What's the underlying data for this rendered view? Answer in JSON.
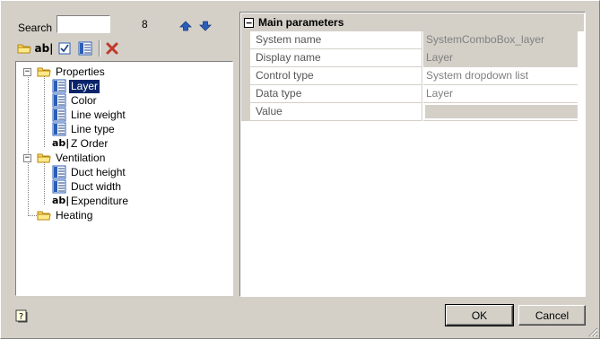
{
  "search": {
    "label": "Search",
    "value": "",
    "count": "8"
  },
  "toolbar": {
    "folder_icon": "folder-icon",
    "text_icon": "text-field-icon",
    "checkbox_icon": "checkbox-icon",
    "list_icon": "list-icon",
    "delete_icon": "delete-icon"
  },
  "tree": {
    "group_properties": "Properties",
    "layer": "Layer",
    "color": "Color",
    "line_weight": "Line weight",
    "line_type": "Line type",
    "z_order": "Z Order",
    "group_ventilation": "Ventilation",
    "duct_height": "Duct height",
    "duct_width": "Duct width",
    "expenditure": "Expenditure",
    "group_heating": "Heating"
  },
  "panel": {
    "header": "Main parameters",
    "rows": [
      {
        "name": "System name",
        "value": "SystemComboBox_layer"
      },
      {
        "name": "Display name",
        "value": "Layer"
      },
      {
        "name": "Control type",
        "value": "System dropdown list"
      },
      {
        "name": "Data type",
        "value": "Layer"
      },
      {
        "name": "Value",
        "value": ""
      }
    ]
  },
  "buttons": {
    "ok": "OK",
    "cancel": "Cancel"
  },
  "colors": {
    "selection": "#0a246a",
    "face": "#d4d0c8",
    "arrow": "#2a5eb8",
    "delete": "#c0392b"
  }
}
